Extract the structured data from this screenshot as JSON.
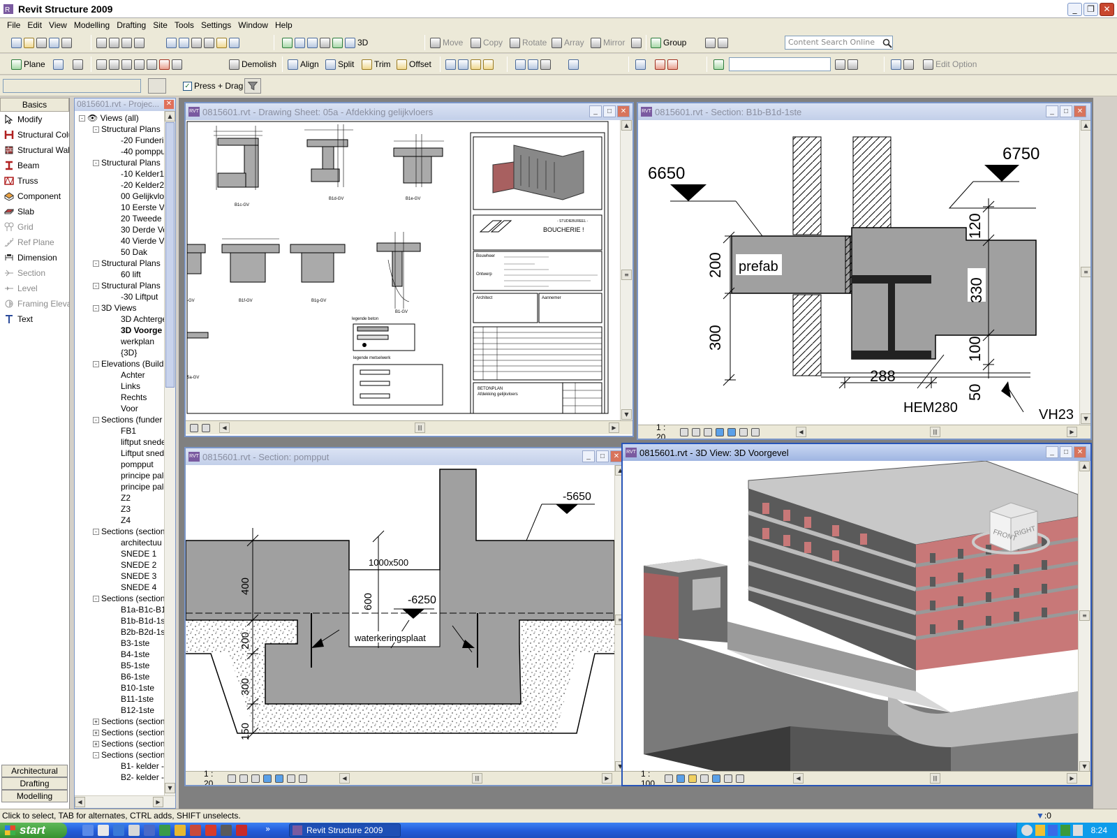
{
  "app": {
    "title": "Revit Structure 2009"
  },
  "menu": [
    "File",
    "Edit",
    "View",
    "Modelling",
    "Drafting",
    "Site",
    "Tools",
    "Settings",
    "Window",
    "Help"
  ],
  "toolbar1": {
    "move": "Move",
    "copy": "Copy",
    "rotate": "Rotate",
    "array": "Array",
    "mirror": "Mirror",
    "group": "Group",
    "view3d": "3D",
    "search_placeholder": "Content Search Online"
  },
  "toolbar2": {
    "plane": "Plane",
    "demolish": "Demolish",
    "align": "Align",
    "split": "Split",
    "trim": "Trim",
    "offset": "Offset",
    "edit_option": "Edit Option"
  },
  "toolbar3": {
    "press_drag": "Press + Drag"
  },
  "palette": {
    "tab": "Basics",
    "items": [
      {
        "label": "Modify",
        "enabled": true
      },
      {
        "label": "Structural Colur",
        "enabled": true
      },
      {
        "label": "Structural Wall",
        "enabled": true
      },
      {
        "label": "Beam",
        "enabled": true
      },
      {
        "label": "Truss",
        "enabled": true
      },
      {
        "label": "Component",
        "enabled": true
      },
      {
        "label": "Slab",
        "enabled": true
      },
      {
        "label": "Grid",
        "enabled": false
      },
      {
        "label": "Ref Plane",
        "enabled": false
      },
      {
        "label": "Dimension",
        "enabled": true
      },
      {
        "label": "Section",
        "enabled": false
      },
      {
        "label": "Level",
        "enabled": false
      },
      {
        "label": "Framing Elevati",
        "enabled": false
      },
      {
        "label": "Text",
        "enabled": true
      }
    ],
    "bottom_tabs": [
      "Architectural",
      "Drafting",
      "Modelling"
    ]
  },
  "browser": {
    "title": "0815601.rvt - Projec...",
    "tree": [
      {
        "t": "Views (all)",
        "l": 0,
        "e": "-"
      },
      {
        "t": "Structural Plans",
        "l": 1,
        "e": "-"
      },
      {
        "t": "-20 Funderin",
        "l": 2
      },
      {
        "t": "-40 pomppu",
        "l": 2
      },
      {
        "t": "Structural Plans",
        "l": 1,
        "e": "-"
      },
      {
        "t": "-10 Kelder1",
        "l": 2
      },
      {
        "t": "-20 Kelder2",
        "l": 2
      },
      {
        "t": "00 Gelijkvloe",
        "l": 2
      },
      {
        "t": "10 Eerste Ve",
        "l": 2
      },
      {
        "t": "20 Tweede V",
        "l": 2
      },
      {
        "t": "30 Derde Ve",
        "l": 2
      },
      {
        "t": "40 Vierde Ve",
        "l": 2
      },
      {
        "t": "50 Dak",
        "l": 2
      },
      {
        "t": "Structural Plans",
        "l": 1,
        "e": "-"
      },
      {
        "t": "60 lift",
        "l": 2
      },
      {
        "t": "Structural Plans",
        "l": 1,
        "e": "-"
      },
      {
        "t": "-30 Liftput",
        "l": 2
      },
      {
        "t": "3D Views",
        "l": 1,
        "e": "-"
      },
      {
        "t": "3D Achterge",
        "l": 2
      },
      {
        "t": "3D Voorge",
        "l": 2,
        "b": true
      },
      {
        "t": "werkplan",
        "l": 2
      },
      {
        "t": "{3D}",
        "l": 2
      },
      {
        "t": "Elevations (Build",
        "l": 1,
        "e": "-"
      },
      {
        "t": "Achter",
        "l": 2
      },
      {
        "t": "Links",
        "l": 2
      },
      {
        "t": "Rechts",
        "l": 2
      },
      {
        "t": "Voor",
        "l": 2
      },
      {
        "t": "Sections (funder",
        "l": 1,
        "e": "-"
      },
      {
        "t": "FB1",
        "l": 2
      },
      {
        "t": "liftput snede",
        "l": 2
      },
      {
        "t": "Liftput snede",
        "l": 2
      },
      {
        "t": "pompput",
        "l": 2
      },
      {
        "t": "principe pale",
        "l": 2
      },
      {
        "t": "principe pale",
        "l": 2
      },
      {
        "t": "Z2",
        "l": 2
      },
      {
        "t": "Z3",
        "l": 2
      },
      {
        "t": "Z4",
        "l": 2
      },
      {
        "t": "Sections (section",
        "l": 1,
        "e": "-"
      },
      {
        "t": "architectuu",
        "l": 2
      },
      {
        "t": "SNEDE 1",
        "l": 2
      },
      {
        "t": "SNEDE 2",
        "l": 2
      },
      {
        "t": "SNEDE 3",
        "l": 2
      },
      {
        "t": "SNEDE 4",
        "l": 2
      },
      {
        "t": "Sections (section",
        "l": 1,
        "e": "-"
      },
      {
        "t": "B1a-B1c-B1",
        "l": 2
      },
      {
        "t": "B1b-B1d-1st",
        "l": 2
      },
      {
        "t": "B2b-B2d-1st",
        "l": 2
      },
      {
        "t": "B3-1ste",
        "l": 2
      },
      {
        "t": "B4-1ste",
        "l": 2
      },
      {
        "t": "B5-1ste",
        "l": 2
      },
      {
        "t": "B6-1ste",
        "l": 2
      },
      {
        "t": "B10-1ste",
        "l": 2
      },
      {
        "t": "B11-1ste",
        "l": 2
      },
      {
        "t": "B12-1ste",
        "l": 2
      },
      {
        "t": "Sections (section",
        "l": 1,
        "e": "+"
      },
      {
        "t": "Sections (section",
        "l": 1,
        "e": "+"
      },
      {
        "t": "Sections (section",
        "l": 1,
        "e": "+"
      },
      {
        "t": "Sections (section",
        "l": 1,
        "e": "-"
      },
      {
        "t": "B1- kelder -",
        "l": 2
      },
      {
        "t": "B2- kelder -",
        "l": 2
      }
    ]
  },
  "views": {
    "sheet": {
      "title": "0815601.rvt - Drawing Sheet: 05a - Afdekking gelijkvloers",
      "details": [
        "B1c-GV",
        "B1d-GV",
        "B1e-GV",
        "-GV",
        "B1f-GV",
        "B1g-GV",
        "B1-GV",
        "5a-GV"
      ],
      "legend1": "legende beton",
      "legend2": "legende metselwerk",
      "company": "BOUCHERIE !",
      "company_sub": "- STUDIEBUREEL -",
      "bouwheer": "Bouwheer",
      "ontwerp": "Ontwerp",
      "architect": "Architect",
      "aannemer": "Aannemer",
      "plan_title": "BETONPLAN",
      "plan_sub": "Afdekking gelijkvloers"
    },
    "section_b1b": {
      "title": "0815601.rvt - Section: B1b-B1d-1ste",
      "scale": "1 : 20",
      "level_left": "6650",
      "level_right": "6750",
      "label_prefab": "prefab",
      "dim_200": "200",
      "dim_300": "300",
      "dim_120": "120",
      "dim_330": "330",
      "dim_100": "100",
      "dim_50": "50",
      "dim_288": "288",
      "beam": "HEM280",
      "tag": "VH23"
    },
    "section_pompput": {
      "title": "0815601.rvt - Section: pompput",
      "scale": "1 : 20",
      "level_top": "-5650",
      "level_inner": "-6250",
      "opening": "1000x500",
      "dim_600": "600",
      "dim_400": "400",
      "dim_200": "200",
      "dim_300": "300",
      "dim_150": "150",
      "note": "waterkeringsplaat"
    },
    "view3d": {
      "title": "0815601.rvt - 3D View: 3D Voorgevel",
      "scale": "1 : 100",
      "cube_front": "FRONT",
      "cube_right": "RIGHT"
    }
  },
  "status": {
    "hint": "Click to select, TAB for alternates, CTRL adds, SHIFT unselects.",
    "filter": ":0"
  },
  "taskbar": {
    "start": "start",
    "task": "Revit Structure 2009",
    "clock": "8:24"
  },
  "colors": {
    "concrete": "#a0a0a0",
    "brick": "#c87878",
    "accent": "#2754b8"
  }
}
